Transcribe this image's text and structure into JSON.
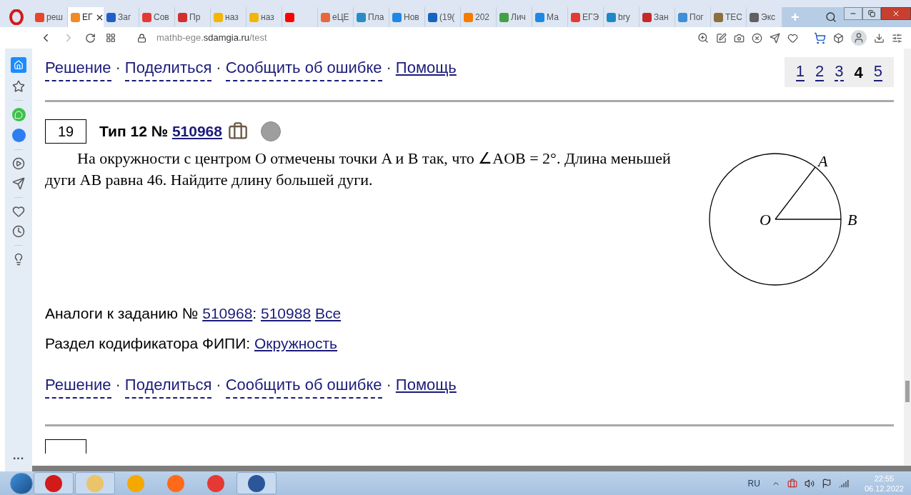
{
  "browser": {
    "tabs": [
      {
        "label": "реш",
        "selected": false,
        "color": "#e8452c"
      },
      {
        "label": "ЕГ",
        "selected": true,
        "color": "#f08a24"
      },
      {
        "label": "Заг",
        "selected": false,
        "color": "#1f5fc9"
      },
      {
        "label": "Сов",
        "selected": false,
        "color": "#e53935"
      },
      {
        "label": "Пр",
        "selected": false,
        "color": "#d32f2f"
      },
      {
        "label": "наз",
        "selected": false,
        "color": "#f2b705"
      },
      {
        "label": "наз",
        "selected": false,
        "color": "#f2b705"
      },
      {
        "selected": false,
        "color": "#ff0000"
      },
      {
        "label": "eЦE",
        "selected": false,
        "color": "#e8673c"
      },
      {
        "label": "Пла",
        "selected": false,
        "color": "#2a8cc7"
      },
      {
        "label": "Нов",
        "selected": false,
        "color": "#1e88e5"
      },
      {
        "label": "(19(",
        "selected": false,
        "color": "#1565c0"
      },
      {
        "label": "202",
        "selected": false,
        "color": "#f57c00"
      },
      {
        "label": "Лич",
        "selected": false,
        "color": "#43a047"
      },
      {
        "label": "Ма",
        "selected": false,
        "color": "#1e88e5"
      },
      {
        "label": "ЕГЭ",
        "selected": false,
        "color": "#e53935"
      },
      {
        "label": "bry",
        "selected": false,
        "color": "#1e88c7"
      },
      {
        "label": "Зан",
        "selected": false,
        "color": "#c62828"
      },
      {
        "label": "Пог",
        "selected": false,
        "color": "#3f8ed8"
      },
      {
        "label": "ТЕС",
        "selected": false,
        "color": "#8d6e3f"
      },
      {
        "label": "Экс",
        "selected": false,
        "color": "#616161"
      }
    ],
    "new_tab": "+",
    "address": {
      "subdomain": "mathb-ege.",
      "domain": "sdamgia.ru",
      "path": "/test"
    }
  },
  "page": {
    "top_links": [
      {
        "label": "Решение",
        "kind": "dashed"
      },
      {
        "label": "Поделиться",
        "kind": "dashed"
      },
      {
        "label": "Сообщить об ошибке",
        "kind": "dashed"
      },
      {
        "label": "Помощь",
        "kind": "solid"
      }
    ],
    "separator": "·",
    "pagination": [
      {
        "label": "1",
        "selected": false
      },
      {
        "label": "2",
        "selected": false
      },
      {
        "label": "3",
        "selected": false
      },
      {
        "label": "4",
        "selected": true
      },
      {
        "label": "5",
        "selected": false
      }
    ],
    "task": {
      "number": "19",
      "type": "Тип 12 №",
      "id": "510968",
      "text": "На окружности с центром O отмечены точки A и B так, что ∠AOB = 2°. Длина меньшей дуги AB равна 46. Найдите длину большей дуги.",
      "figure": {
        "center": "O",
        "point_a": "A",
        "point_b": "B"
      }
    },
    "analogues": {
      "label": "Аналоги к заданию №",
      "links": [
        "510968",
        "510988"
      ],
      "colon": ":",
      "all": "Все"
    },
    "codifier": {
      "label": "Раздел кодификатора ФИПИ:",
      "link": "Окружность"
    },
    "bottom_links": [
      {
        "label": "Решение",
        "kind": "dashed"
      },
      {
        "label": "Поделиться",
        "kind": "dashed"
      },
      {
        "label": "Сообщить об ошибке",
        "kind": "dashed"
      },
      {
        "label": "Помощь",
        "kind": "solid"
      }
    ],
    "sidebar_more": "···"
  },
  "taskbar": {
    "language": "RU",
    "time": "22:55",
    "date": "06.12.2022"
  }
}
